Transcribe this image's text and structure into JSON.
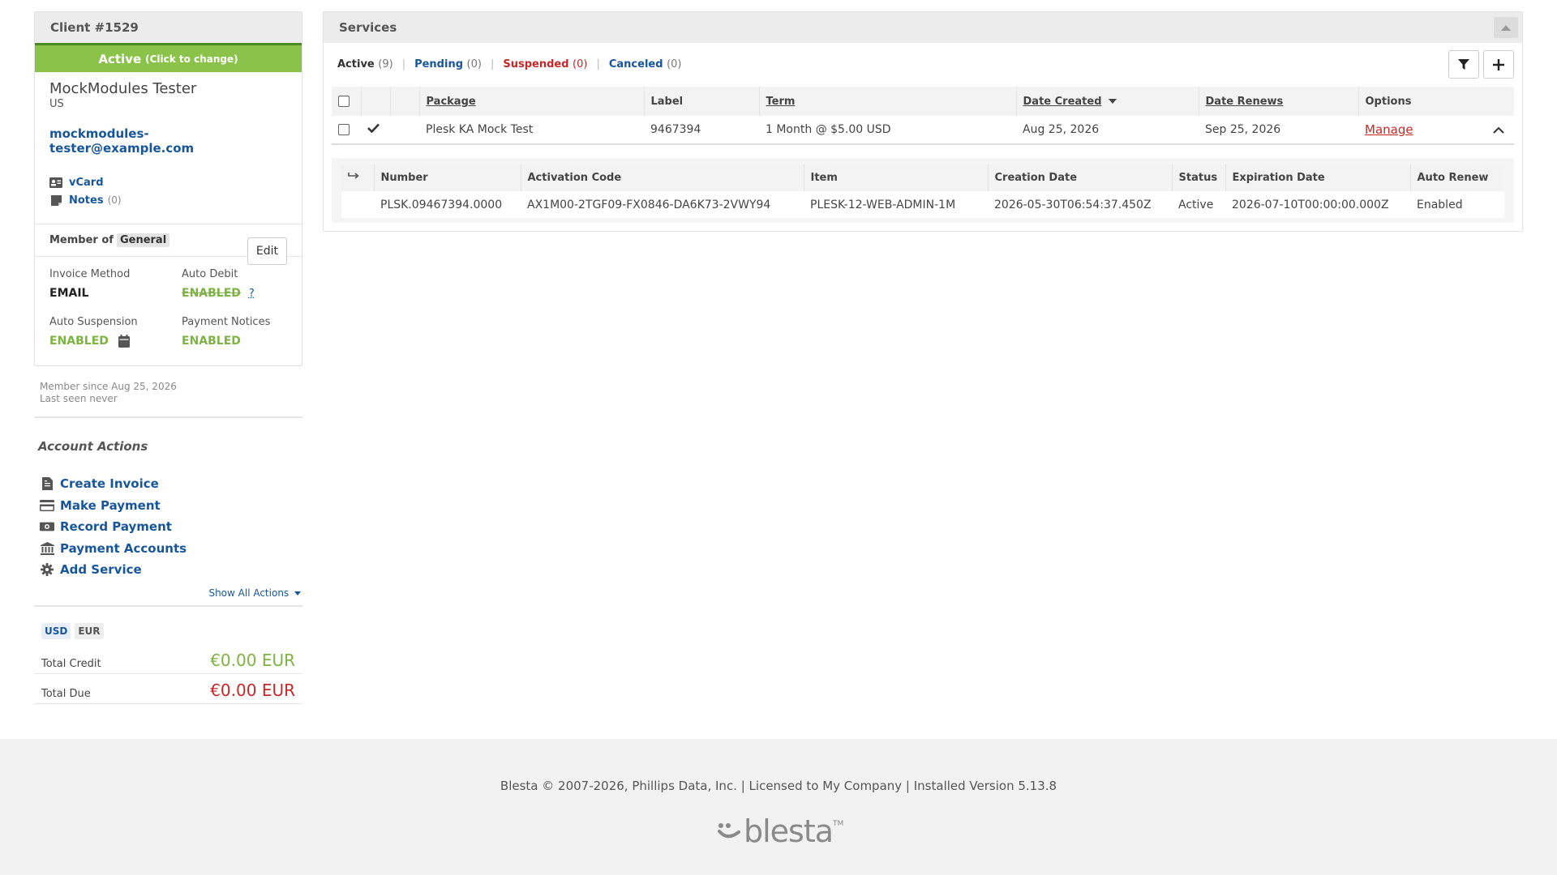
{
  "client": {
    "title": "Client #1529",
    "status": "Active",
    "status_hint": "(Click to change)",
    "name": "MockModules Tester",
    "country": "US",
    "email": "mockmodules-tester@example.com",
    "vcard_label": "vCard",
    "notes_label": "Notes",
    "notes_count": "(0)",
    "edit_label": "Edit",
    "member_of_label": "Member of",
    "group": "General",
    "invoice_method_label": "Invoice Method",
    "invoice_method": "EMAIL",
    "auto_debit_label": "Auto Debit",
    "auto_debit": "ENABLED",
    "auto_debit_help": "?",
    "auto_suspension_label": "Auto Suspension",
    "auto_suspension": "ENABLED",
    "payment_notices_label": "Payment Notices",
    "payment_notices": "ENABLED",
    "member_since": "Member since Aug 25, 2026",
    "last_seen": "Last seen never"
  },
  "actions": {
    "title": "Account Actions",
    "items": [
      {
        "label": "Create Invoice",
        "icon": "invoice-icon"
      },
      {
        "label": "Make Payment",
        "icon": "credit-card-icon"
      },
      {
        "label": "Record Payment",
        "icon": "money-icon"
      },
      {
        "label": "Payment Accounts",
        "icon": "bank-icon"
      },
      {
        "label": "Add Service",
        "icon": "gear-icon"
      }
    ],
    "show_all": "Show All Actions"
  },
  "currency": {
    "tabs": [
      "USD",
      "EUR"
    ],
    "total_credit_label": "Total Credit",
    "total_credit": "€0.00 EUR",
    "total_due_label": "Total Due",
    "total_due": "€0.00 EUR"
  },
  "services": {
    "title": "Services",
    "tabs": [
      {
        "label": "Active",
        "count": "(9)"
      },
      {
        "label": "Pending",
        "count": "(0)"
      },
      {
        "label": "Suspended",
        "count": "(0)"
      },
      {
        "label": "Canceled",
        "count": "(0)"
      }
    ],
    "columns": [
      "Package",
      "Label",
      "Term",
      "Date Created",
      "Date Renews",
      "Options"
    ],
    "row": {
      "package": "Plesk KA Mock Test",
      "label": "9467394",
      "term": "1 Month @ $5.00 USD",
      "date_created": "Aug 25, 2026",
      "date_renews": "Sep 25, 2026",
      "manage": "Manage"
    },
    "sub_columns": [
      "Number",
      "Activation Code",
      "Item",
      "Creation Date",
      "Status",
      "Expiration Date",
      "Auto Renew"
    ],
    "sub_row": {
      "number": "PLSK.09467394.0000",
      "activation_code": "AX1M00-2TGF09-FX0846-DA6K73-2VWY94",
      "item": "PLESK-12-WEB-ADMIN-1M",
      "creation_date": "2026-05-30T06:54:37.450Z",
      "status": "Active",
      "expiration_date": "2026-07-10T00:00:00.000Z",
      "auto_renew": "Enabled"
    }
  },
  "footer": {
    "text": "Blesta © 2007-2026, Phillips Data, Inc. | Licensed to My Company | Installed Version 5.13.8",
    "logo_word": "blesta",
    "logo_tm": "TM"
  },
  "colors": {
    "accent_blue": "#17569b",
    "active_green": "#8bc34a",
    "danger_red": "#c62828"
  }
}
